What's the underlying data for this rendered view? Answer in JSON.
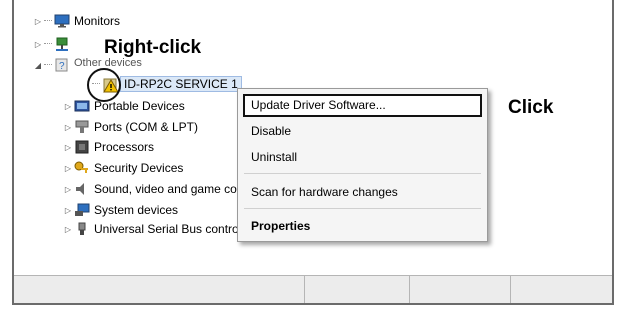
{
  "tree": {
    "monitors": "Monitors",
    "other_devices": "Other devices",
    "device": "ID-RP2C SERVICE 1",
    "portable": "Portable Devices",
    "ports": "Ports (COM & LPT)",
    "processors": "Processors",
    "security": "Security Devices",
    "sound": "Sound, video and game controllers",
    "system": "System devices",
    "usb": "Universal Serial Bus controllers"
  },
  "callouts": {
    "right_click": "Right-click",
    "click": "Click"
  },
  "menu": {
    "update": "Update Driver Software...",
    "disable": "Disable",
    "uninstall": "Uninstall",
    "scan": "Scan for hardware changes",
    "properties": "Properties"
  }
}
